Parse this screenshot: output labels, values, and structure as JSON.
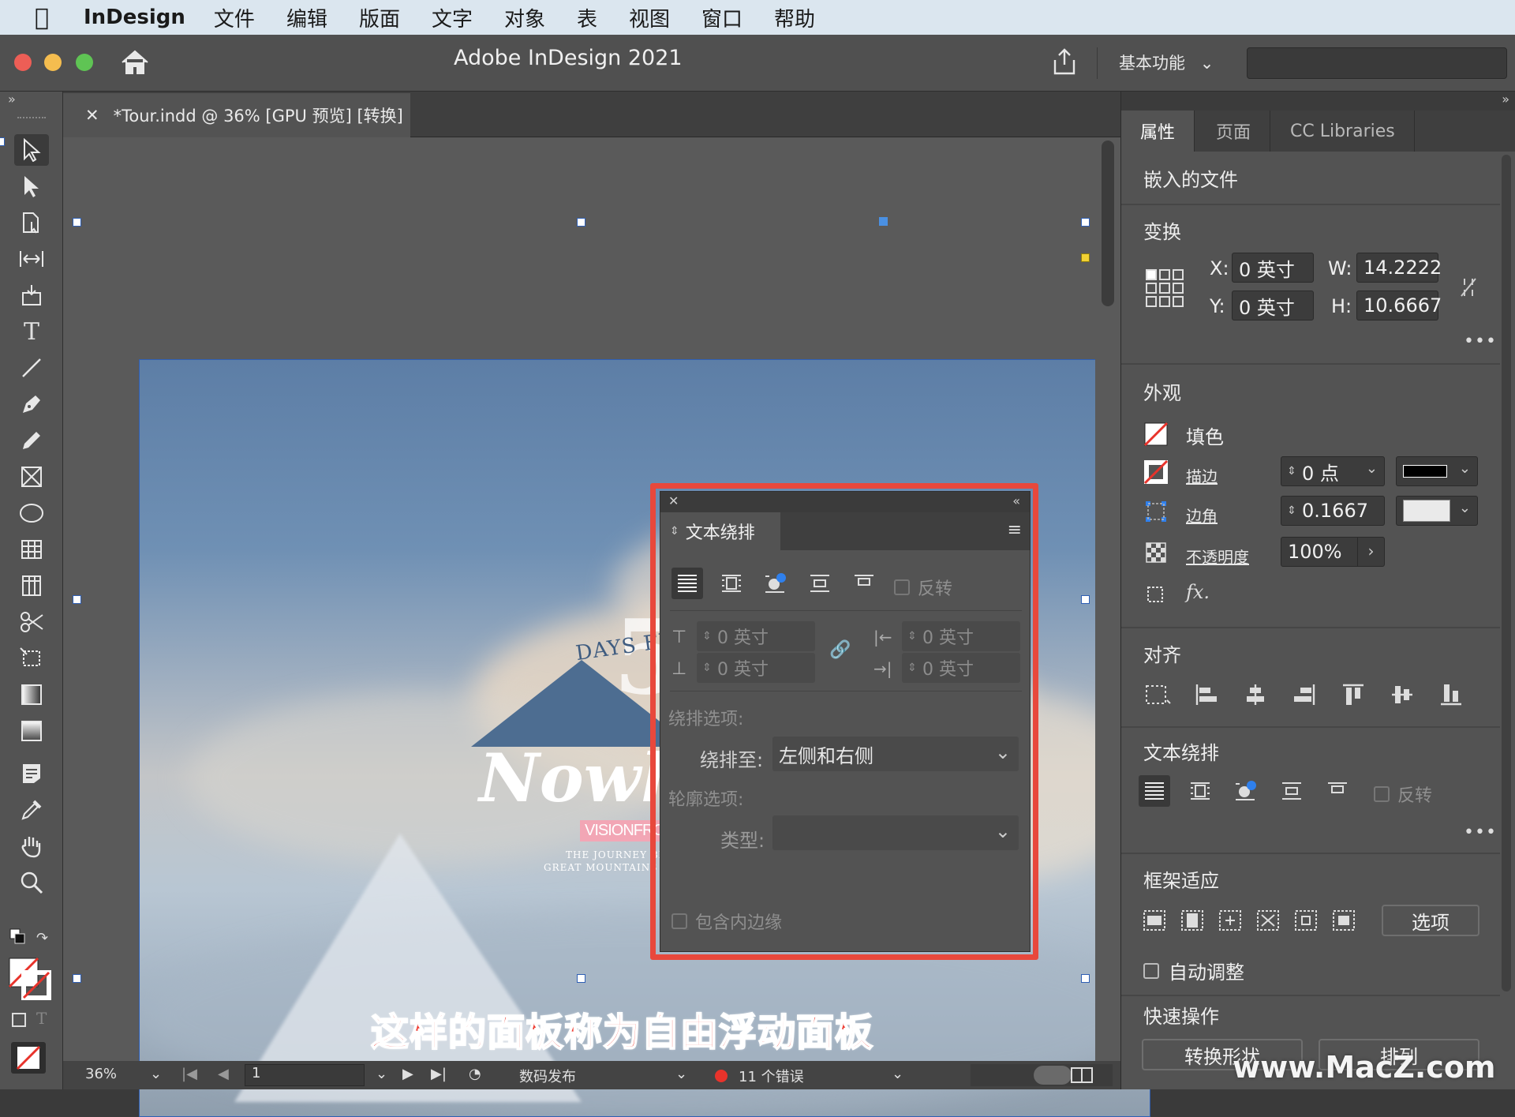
{
  "menubar": {
    "app_name": "InDesign",
    "items": [
      "文件",
      "编辑",
      "版面",
      "文字",
      "对象",
      "表",
      "视图",
      "窗口",
      "帮助"
    ]
  },
  "titlebar": {
    "title": "Adobe InDesign 2021",
    "workspace": "基本功能"
  },
  "document": {
    "tab_label": "*Tour.indd @ 36% [GPU 预览] [转换]"
  },
  "artwork": {
    "big_number": "5",
    "days_from": "DAYS FROM",
    "nowhere": "Nowhe",
    "vision": "VISIONFROMNEPAL",
    "line1": "THE JOURNEY BEGINS IN TH",
    "line2": "GREAT MOUNTAINS OF THE HIMA"
  },
  "float_panel": {
    "tab_label": "文本绕排",
    "invert_label": "反转",
    "offset_top": "0 英寸",
    "offset_bottom": "0 英寸",
    "offset_left": "0 英寸",
    "offset_right": "0 英寸",
    "wrap_options_label": "绕排选项:",
    "wrap_to_label": "绕排至:",
    "wrap_to_value": "左侧和右侧",
    "contour_options_label": "轮廓选项:",
    "type_label": "类型:",
    "type_value": "",
    "include_inside_edges": "包含内边缘"
  },
  "right_panel": {
    "tabs": [
      "属性",
      "页面",
      "CC Libraries"
    ],
    "embedded_file": "嵌入的文件",
    "transform": {
      "title": "变换",
      "x_label": "X:",
      "x_value": "0 英寸",
      "y_label": "Y:",
      "y_value": "0 英寸",
      "w_label": "W:",
      "w_value": "14.2222",
      "h_label": "H:",
      "h_value": "10.6667"
    },
    "appearance": {
      "title": "外观",
      "fill_label": "填色",
      "stroke_label": "描边",
      "stroke_value": "0 点",
      "corner_label": "边角",
      "corner_value": "0.1667",
      "opacity_label": "不透明度",
      "opacity_value": "100%"
    },
    "align_title": "对齐",
    "text_wrap": {
      "title": "文本绕排",
      "invert_label": "反转"
    },
    "frame_fitting": {
      "title": "框架适应",
      "options_button": "选项",
      "auto_fit_label": "自动调整"
    },
    "quick_actions": {
      "title": "快速操作",
      "convert_shape": "转换形状",
      "arrange": "排列"
    }
  },
  "statusbar": {
    "zoom": "36%",
    "page": "1",
    "profile": "数码发布",
    "errors": "11 个错误"
  },
  "caption": "这样的面板称为自由浮动面板",
  "watermark": "www.MacZ.com",
  "colors": {
    "highlight_outline": "#e8483c",
    "error_dot": "#e8332b",
    "selection": "#2f5fb4"
  }
}
